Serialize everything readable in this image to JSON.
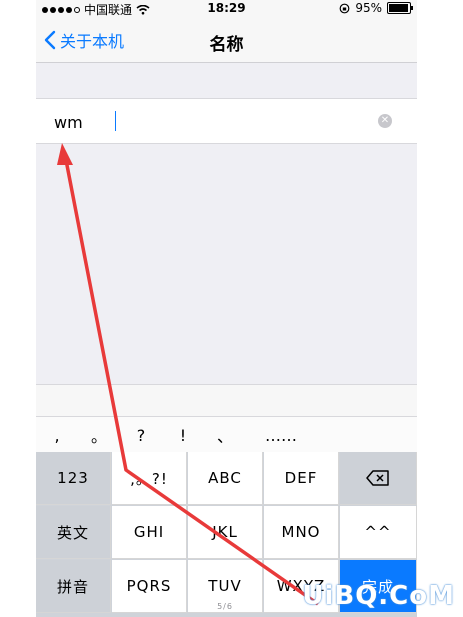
{
  "status_bar": {
    "carrier": "中国联通",
    "time": "18:29",
    "battery": "95%",
    "battery_level": 0.95
  },
  "nav": {
    "back_label": "关于本机",
    "title": "名称"
  },
  "name_field": {
    "value": "wm"
  },
  "punctuation": [
    ",",
    "。",
    "?",
    "!",
    "、",
    "……"
  ],
  "keyboard": {
    "row1": [
      "123",
      ",。?!",
      "ABC",
      "DEF"
    ],
    "row2": [
      "英文",
      "GHI",
      "JKL",
      "MNO",
      "^^"
    ],
    "row3": [
      "拼音",
      "PQRS",
      "TUV",
      "WXYZ",
      "完成"
    ],
    "tuv_sub": "5/6"
  },
  "watermark": "UiBQ.CoM",
  "colors": {
    "accent": "#0a7aff",
    "annotation": "#e83a3a"
  }
}
